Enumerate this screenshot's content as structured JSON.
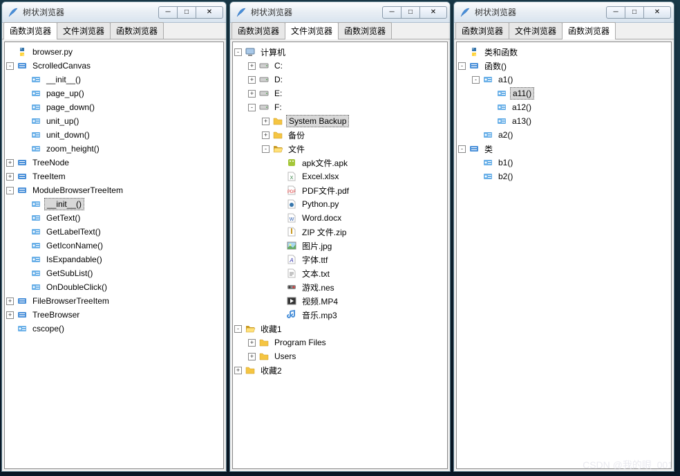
{
  "watermark": "CSDN @我的眼_001",
  "windows": [
    {
      "title": "树状浏览器",
      "tabs": [
        {
          "label": "函数浏览器",
          "active": true
        },
        {
          "label": "文件浏览器",
          "active": false
        },
        {
          "label": "函数浏览器",
          "active": false
        }
      ],
      "tree": [
        {
          "depth": 0,
          "exp": null,
          "icon": "python",
          "label": "browser.py"
        },
        {
          "depth": 0,
          "exp": "-",
          "icon": "class",
          "label": "ScrolledCanvas"
        },
        {
          "depth": 1,
          "exp": null,
          "icon": "method",
          "label": "__init__()"
        },
        {
          "depth": 1,
          "exp": null,
          "icon": "method",
          "label": "page_up()"
        },
        {
          "depth": 1,
          "exp": null,
          "icon": "method",
          "label": "page_down()"
        },
        {
          "depth": 1,
          "exp": null,
          "icon": "method",
          "label": "unit_up()"
        },
        {
          "depth": 1,
          "exp": null,
          "icon": "method",
          "label": "unit_down()"
        },
        {
          "depth": 1,
          "exp": null,
          "icon": "method",
          "label": "zoom_height()"
        },
        {
          "depth": 0,
          "exp": "+",
          "icon": "class",
          "label": "TreeNode"
        },
        {
          "depth": 0,
          "exp": "+",
          "icon": "class",
          "label": "TreeItem"
        },
        {
          "depth": 0,
          "exp": "-",
          "icon": "class",
          "label": "ModuleBrowserTreeItem"
        },
        {
          "depth": 1,
          "exp": null,
          "icon": "method",
          "label": "__init__()",
          "selected": true
        },
        {
          "depth": 1,
          "exp": null,
          "icon": "method",
          "label": "GetText()"
        },
        {
          "depth": 1,
          "exp": null,
          "icon": "method",
          "label": "GetLabelText()"
        },
        {
          "depth": 1,
          "exp": null,
          "icon": "method",
          "label": "GetIconName()"
        },
        {
          "depth": 1,
          "exp": null,
          "icon": "method",
          "label": "IsExpandable()"
        },
        {
          "depth": 1,
          "exp": null,
          "icon": "method",
          "label": "GetSubList()"
        },
        {
          "depth": 1,
          "exp": null,
          "icon": "method",
          "label": "OnDoubleClick()"
        },
        {
          "depth": 0,
          "exp": "+",
          "icon": "class",
          "label": "FileBrowserTreeItem"
        },
        {
          "depth": 0,
          "exp": "+",
          "icon": "class",
          "label": "TreeBrowser"
        },
        {
          "depth": 0,
          "exp": null,
          "icon": "method",
          "label": "cscope()"
        }
      ]
    },
    {
      "title": "树状浏览器",
      "tabs": [
        {
          "label": "函数浏览器",
          "active": false
        },
        {
          "label": "文件浏览器",
          "active": true
        },
        {
          "label": "函数浏览器",
          "active": false
        }
      ],
      "tree": [
        {
          "depth": 0,
          "exp": "-",
          "icon": "computer",
          "label": "计算机"
        },
        {
          "depth": 1,
          "exp": "+",
          "icon": "drive",
          "label": "C:"
        },
        {
          "depth": 1,
          "exp": "+",
          "icon": "drive",
          "label": "D:"
        },
        {
          "depth": 1,
          "exp": "+",
          "icon": "drive",
          "label": "E:"
        },
        {
          "depth": 1,
          "exp": "-",
          "icon": "drive",
          "label": "F:"
        },
        {
          "depth": 2,
          "exp": "+",
          "icon": "folder",
          "label": "System Backup",
          "selected": true
        },
        {
          "depth": 2,
          "exp": "+",
          "icon": "folder",
          "label": "备份"
        },
        {
          "depth": 2,
          "exp": "-",
          "icon": "folder-open",
          "label": "文件"
        },
        {
          "depth": 3,
          "exp": null,
          "icon": "file-apk",
          "label": "apk文件.apk"
        },
        {
          "depth": 3,
          "exp": null,
          "icon": "file-xlsx",
          "label": "Excel.xlsx"
        },
        {
          "depth": 3,
          "exp": null,
          "icon": "file-pdf",
          "label": "PDF文件.pdf"
        },
        {
          "depth": 3,
          "exp": null,
          "icon": "file-py",
          "label": "Python.py"
        },
        {
          "depth": 3,
          "exp": null,
          "icon": "file-doc",
          "label": "Word.docx"
        },
        {
          "depth": 3,
          "exp": null,
          "icon": "file-zip",
          "label": "ZIP 文件.zip"
        },
        {
          "depth": 3,
          "exp": null,
          "icon": "file-img",
          "label": "图片.jpg"
        },
        {
          "depth": 3,
          "exp": null,
          "icon": "file-ttf",
          "label": "字体.ttf"
        },
        {
          "depth": 3,
          "exp": null,
          "icon": "file-txt",
          "label": "文本.txt"
        },
        {
          "depth": 3,
          "exp": null,
          "icon": "file-nes",
          "label": "游戏.nes"
        },
        {
          "depth": 3,
          "exp": null,
          "icon": "file-mp4",
          "label": "视频.MP4"
        },
        {
          "depth": 3,
          "exp": null,
          "icon": "file-mp3",
          "label": "音乐.mp3"
        },
        {
          "depth": 0,
          "exp": "-",
          "icon": "folder-open",
          "label": "收藏1"
        },
        {
          "depth": 1,
          "exp": "+",
          "icon": "folder",
          "label": "Program Files"
        },
        {
          "depth": 1,
          "exp": "+",
          "icon": "folder",
          "label": "Users"
        },
        {
          "depth": 0,
          "exp": "+",
          "icon": "folder",
          "label": "收藏2"
        }
      ]
    },
    {
      "title": "树状浏览器",
      "tabs": [
        {
          "label": "函数浏览器",
          "active": false
        },
        {
          "label": "文件浏览器",
          "active": false
        },
        {
          "label": "函数浏览器",
          "active": true
        }
      ],
      "tree": [
        {
          "depth": 0,
          "exp": null,
          "icon": "python",
          "label": "类和函数"
        },
        {
          "depth": 0,
          "exp": "-",
          "icon": "class",
          "label": "函数()"
        },
        {
          "depth": 1,
          "exp": "-",
          "icon": "method",
          "label": "a1()"
        },
        {
          "depth": 2,
          "exp": null,
          "icon": "method",
          "label": "a11()",
          "selected": true
        },
        {
          "depth": 2,
          "exp": null,
          "icon": "method",
          "label": "a12()"
        },
        {
          "depth": 2,
          "exp": null,
          "icon": "method",
          "label": "a13()"
        },
        {
          "depth": 1,
          "exp": null,
          "icon": "method",
          "label": "a2()"
        },
        {
          "depth": 0,
          "exp": "-",
          "icon": "class",
          "label": "类"
        },
        {
          "depth": 1,
          "exp": null,
          "icon": "method",
          "label": "b1()"
        },
        {
          "depth": 1,
          "exp": null,
          "icon": "method",
          "label": "b2()"
        }
      ]
    }
  ],
  "win_controls": {
    "min": "─",
    "max": "□",
    "close": "✕"
  }
}
